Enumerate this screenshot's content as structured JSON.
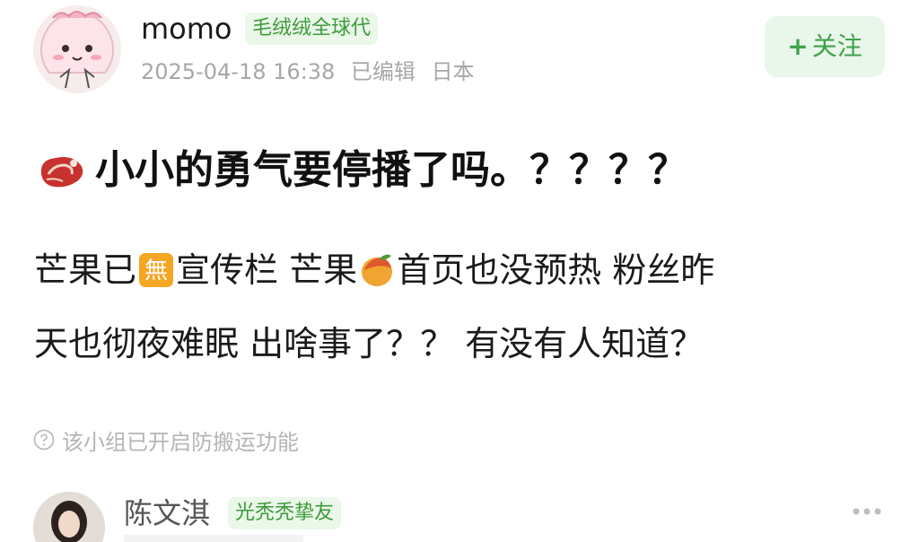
{
  "author": {
    "name": "momo",
    "group_badge": "毛绒绒全球代",
    "timestamp": "2025-04-18 16:38",
    "edited": "已编辑",
    "location": "日本"
  },
  "follow_button": {
    "plus": "+",
    "label": "关注"
  },
  "post": {
    "title_icon": "steak-emoji",
    "title": "小小的勇气要停播了吗。？？？？",
    "body": {
      "line1_part1": "芒果已",
      "line1_emoji1": "无-square-emoji",
      "line1_part2": "宣传栏  芒果",
      "line1_emoji2": "mango-emoji",
      "line1_part3": "首页也没预热 粉丝昨",
      "line2": "天也彻夜难眠 出啥事了？？ 有没有人知道？"
    }
  },
  "notice": {
    "icon": "question-circle-icon",
    "text": "该小组已开启防搬运功能"
  },
  "comment": {
    "name": "陈文淇",
    "badge": "光秃秃挚友"
  },
  "colors": {
    "badge_bg": "#eaf7e9",
    "badge_text": "#3e9b3b",
    "follow_bg": "#e9f6ea",
    "follow_text": "#3ea34a",
    "meta_text": "#a7a7a7"
  }
}
